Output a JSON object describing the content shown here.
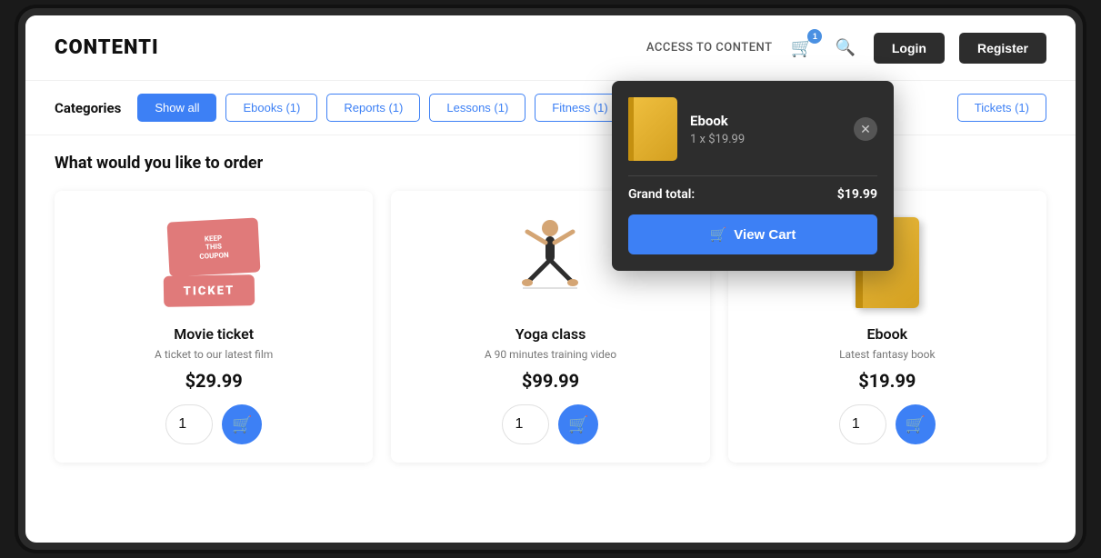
{
  "header": {
    "logo": "CONTENTI",
    "access_label": "ACCESS TO CONTENT",
    "cart_count": "1",
    "login_label": "Login",
    "register_label": "Register"
  },
  "categories": {
    "label": "Categories",
    "items": [
      {
        "id": "show-all",
        "label": "Show all",
        "active": true
      },
      {
        "id": "ebooks",
        "label": "Ebooks (1)",
        "active": false
      },
      {
        "id": "reports",
        "label": "Reports (1)",
        "active": false
      },
      {
        "id": "lessons",
        "label": "Lessons (1)",
        "active": false
      },
      {
        "id": "fitness",
        "label": "Fitness (1)",
        "active": false
      },
      {
        "id": "tickets",
        "label": "Tickets (1)",
        "active": false
      }
    ]
  },
  "section_title": "What would you like to order",
  "products": [
    {
      "id": "movie-ticket",
      "name": "Movie ticket",
      "description": "A ticket to our latest film",
      "price": "$29.99",
      "qty": "1"
    },
    {
      "id": "yoga-class",
      "name": "Yoga class",
      "description": "A 90 minutes training video",
      "price": "$99.99",
      "qty": "1"
    },
    {
      "id": "ebook",
      "name": "Ebook",
      "description": "Latest fantasy book",
      "price": "$19.99",
      "qty": "1"
    }
  ],
  "cart_dropdown": {
    "item_name": "Ebook",
    "item_qty_price": "1 x $19.99",
    "grand_total_label": "Grand total:",
    "grand_total_value": "$19.99",
    "view_cart_label": "View Cart"
  }
}
